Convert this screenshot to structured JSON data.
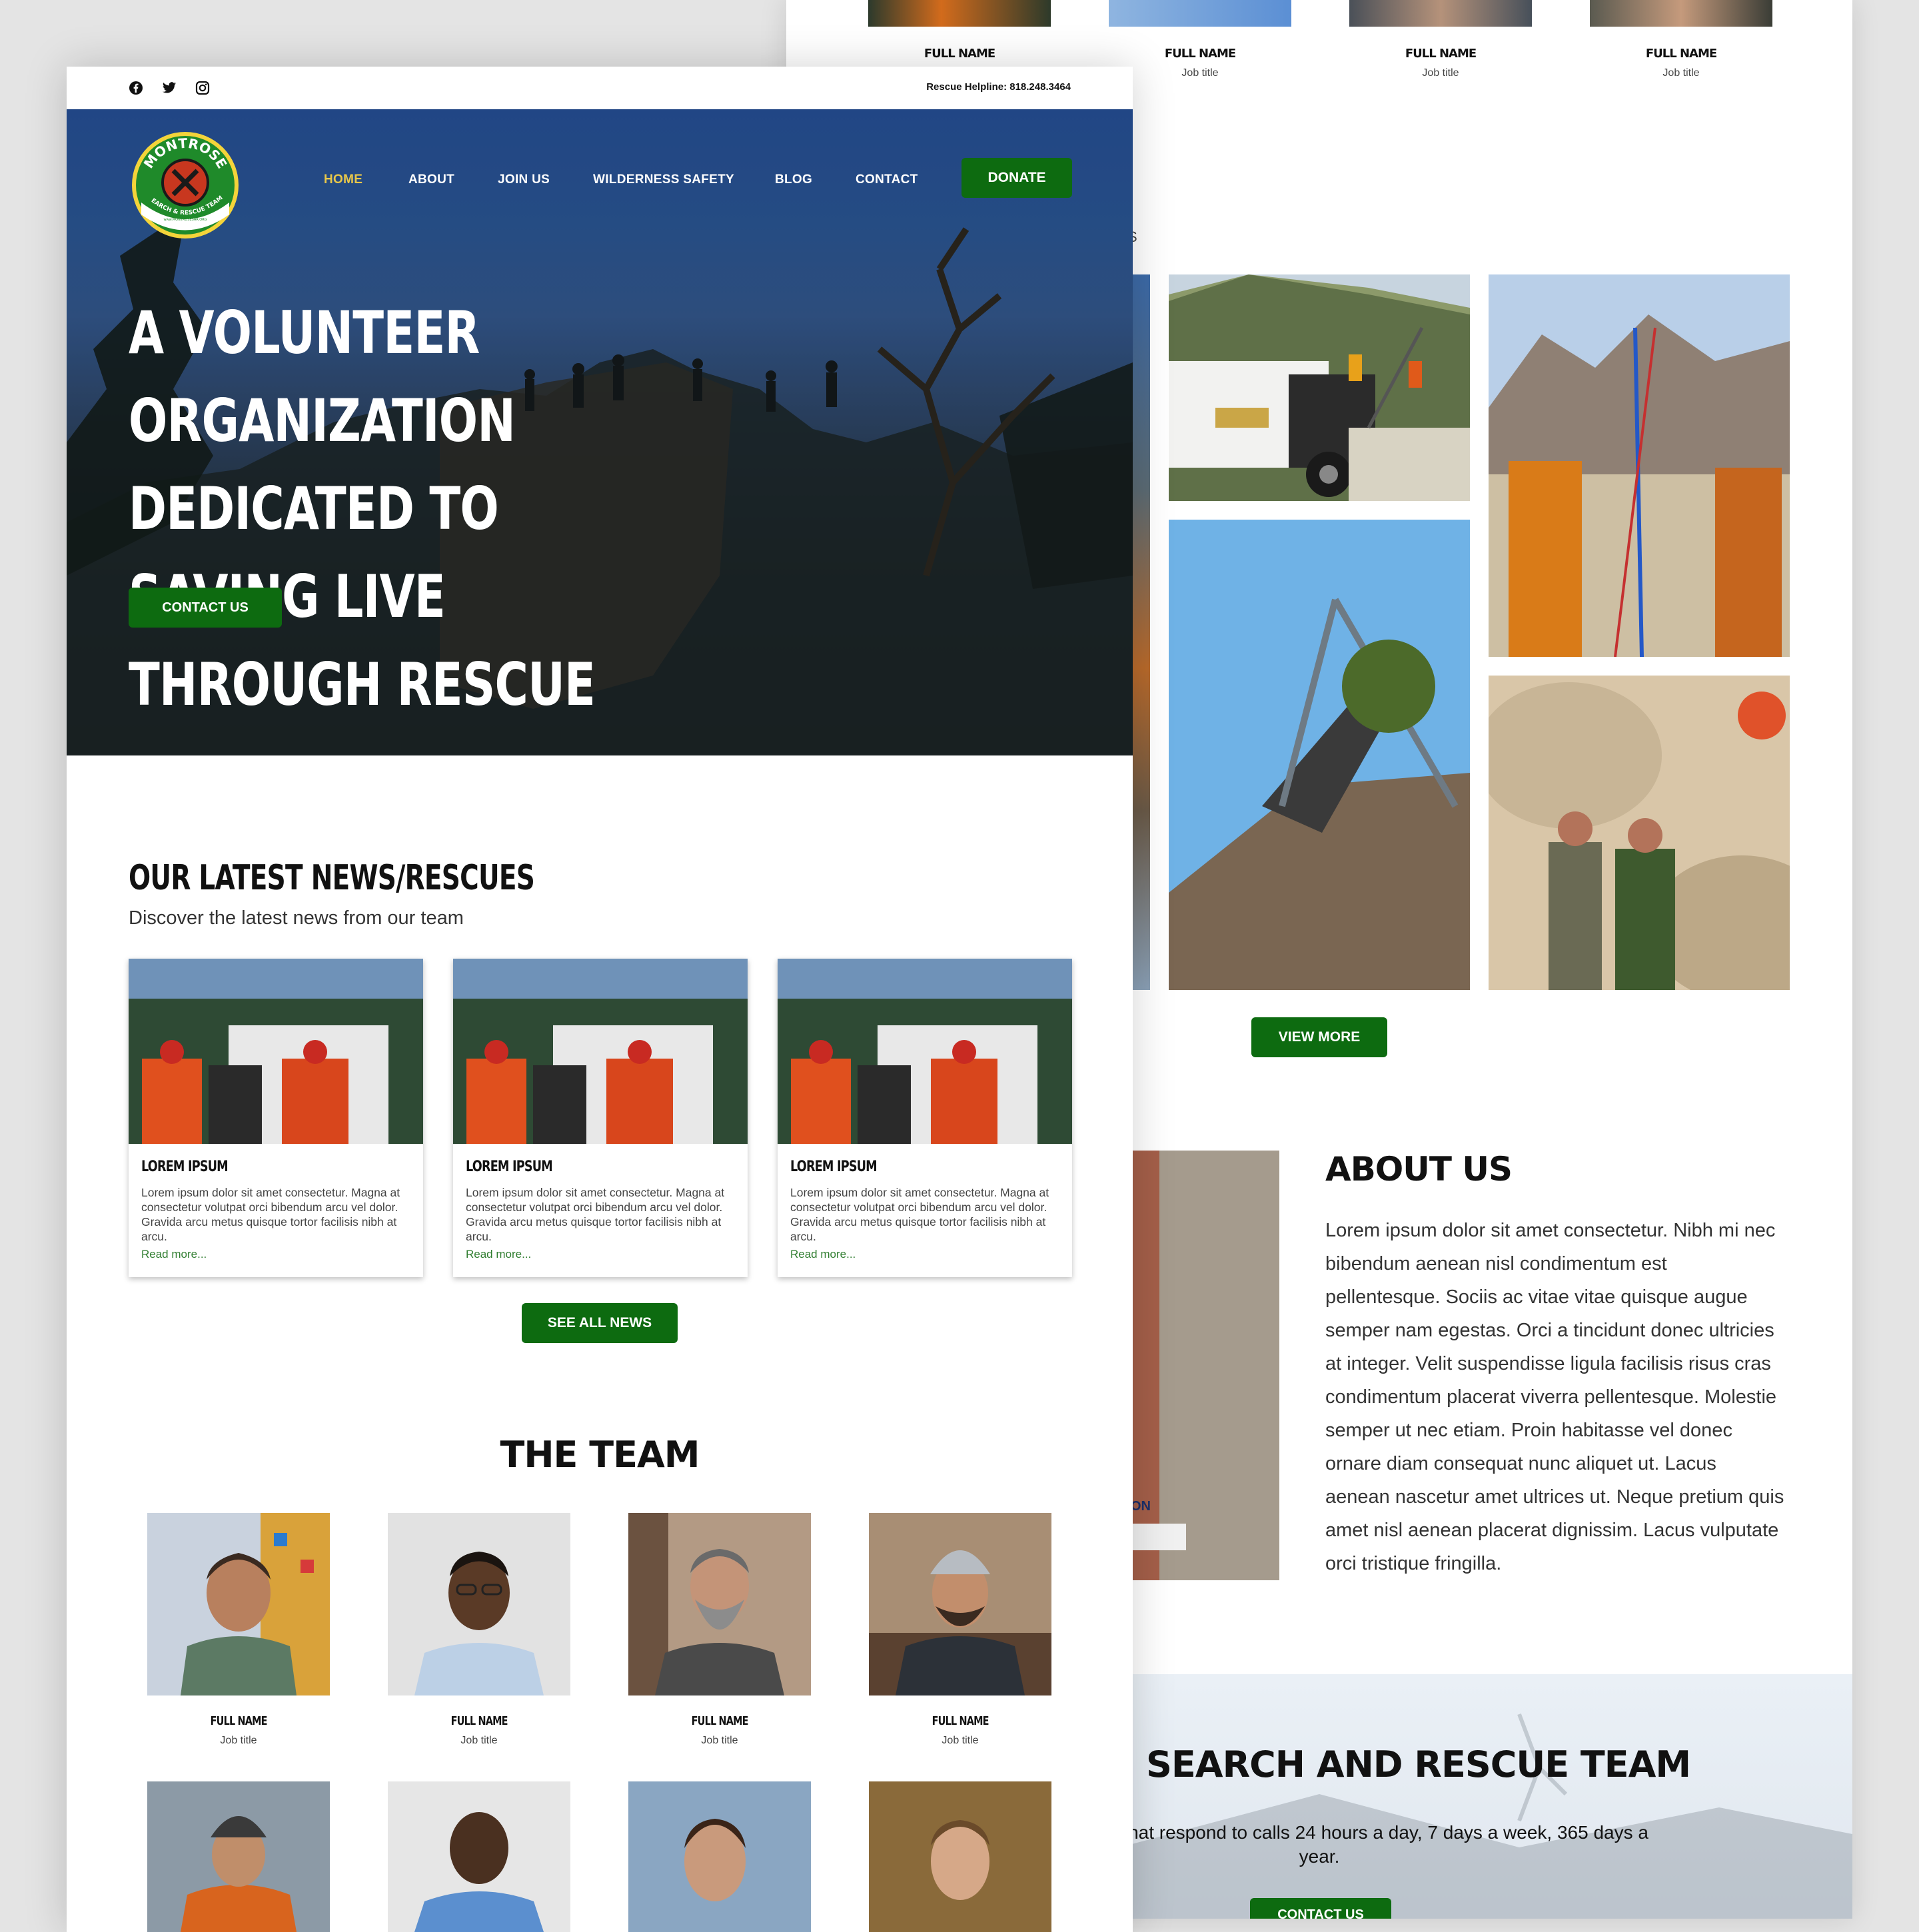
{
  "colors": {
    "brand_green": "#0d6b10",
    "nav_active": "#e9c84a",
    "link_green": "#2f7d2f"
  },
  "back": {
    "top_team": [
      {
        "name": "FULL NAME",
        "title": ""
      },
      {
        "name": "FULL NAME",
        "title": "Job title"
      },
      {
        "name": "FULL NAME",
        "title": "Job title"
      },
      {
        "name": "FULL NAME",
        "title": "Job title"
      }
    ],
    "gallery_caption_fragment": "S",
    "view_more": "VIEW MORE",
    "about": {
      "title": "ABOUT US",
      "text": "Lorem ipsum dolor sit amet consectetur. Nibh mi nec bibendum aenean nisl condimentum est pellentesque. Sociis ac vitae vitae quisque augue semper nam egestas. Orci a tincidunt donec ultricies at integer. Velit suspendisse ligula facilisis risus cras condimentum placerat viverra pellentesque. Molestie semper ut nec etiam. Proin habitasse vel donec ornare diam consequat nunc aliquet ut. Lacus aenean nascetur amet ultrices ut. Neque pretium quis amet nisl aenean placerat dignissim. Lacus vulputate orci tristique fringilla.",
      "banner_fragment": "ON"
    },
    "sar": {
      "title": "SEARCH AND RESCUE TEAM",
      "text": "ated volunteers that respond to calls 24 hours a day, 7 days a week, 365 days a year.",
      "button": "CONTACT US"
    }
  },
  "front": {
    "social_icons": [
      "facebook-icon",
      "twitter-icon",
      "instagram-icon"
    ],
    "helpline": "Rescue Helpline: 818.248.3464",
    "logo": {
      "top": "MONTROSE",
      "bottom": "SEARCH & RESCUE TEAM",
      "small": "www.MONTROSESAR.ORG"
    },
    "nav": [
      "HOME",
      "ABOUT",
      "JOIN US",
      "WILDERNESS SAFETY",
      "BLOG",
      "CONTACT"
    ],
    "nav_active": "HOME",
    "donate": "DONATE",
    "hero": {
      "line1": "A VOLUNTEER ORGANIZATION",
      "line2": "DEDICATED TO SAVING LIVE",
      "line3": "THROUGH RESCUE",
      "cta": "CONTACT US"
    },
    "news": {
      "title": "OUR LATEST NEWS/RESCUES",
      "subtitle": "Discover the latest news from our team",
      "cards": [
        {
          "title": "LOREM IPSUM",
          "text": "Lorem ipsum dolor sit amet consectetur. Magna at consectetur volutpat orci bibendum arcu vel dolor. Gravida arcu metus quisque tortor facilisis nibh at arcu.",
          "link": "Read more..."
        },
        {
          "title": "LOREM IPSUM",
          "text": "Lorem ipsum dolor sit amet consectetur. Magna at consectetur volutpat orci bibendum arcu vel dolor. Gravida arcu metus quisque tortor facilisis nibh at arcu.",
          "link": "Read more..."
        },
        {
          "title": "LOREM IPSUM",
          "text": "Lorem ipsum dolor sit amet consectetur. Magna at consectetur volutpat orci bibendum arcu vel dolor. Gravida arcu metus quisque tortor facilisis nibh at arcu.",
          "link": "Read more..."
        }
      ],
      "see_all": "SEE ALL NEWS"
    },
    "team": {
      "title": "THE TEAM",
      "members": [
        {
          "name": "FULL NAME",
          "title": "Job title"
        },
        {
          "name": "FULL NAME",
          "title": "Job title"
        },
        {
          "name": "FULL NAME",
          "title": "Job title"
        },
        {
          "name": "FULL NAME",
          "title": "Job title"
        }
      ]
    }
  }
}
